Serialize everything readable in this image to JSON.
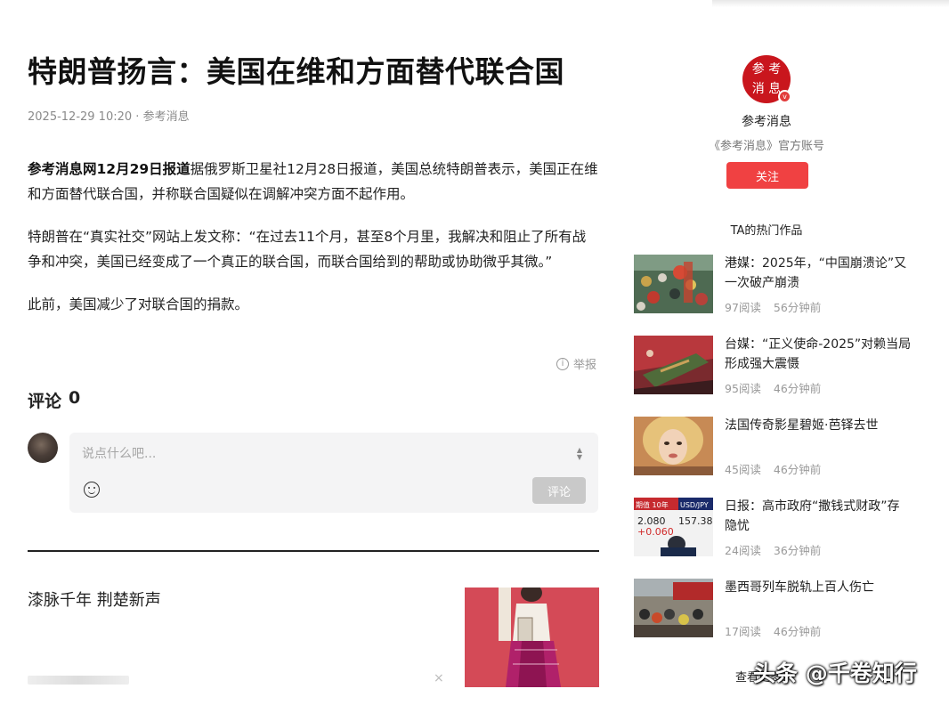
{
  "article": {
    "title": "特朗普扬言：美国在维和方面替代联合国",
    "date": "2025-12-29 10:20",
    "meta_sep": "·",
    "source": "参考消息",
    "p1_lead": "参考消息网12月29日报道",
    "p1_body": "据俄罗斯卫星社12月28日报道，美国总统特朗普表示，美国正在维和方面替代联合国，并称联合国疑似在调解冲突方面不起作用。",
    "p2": "特朗普在“真实社交”网站上发文称：“在过去11个月，甚至8个月里，我解决和阻止了所有战争和冲突，美国已经变成了一个真正的联合国，而联合国给到的帮助或协助微乎其微。”",
    "p3": "此前，美国减少了对联合国的捐款。",
    "report": "举报"
  },
  "comments": {
    "label": "评论",
    "count": "0",
    "placeholder": "说点什么吧...",
    "submit": "评论"
  },
  "recommendation": {
    "title": "漆脉千年 荆楚新声"
  },
  "sidebar": {
    "logo_text_1": "参 考",
    "logo_text_2": "消 息",
    "verified": "v",
    "account_name": "参考消息",
    "account_desc": "《参考消息》官方账号",
    "follow": "关注",
    "hot_title": "TA的热门作品",
    "items": [
      {
        "title": "港媒：2025年，“中国崩溃论”又一次破产崩溃",
        "reads": "97阅读",
        "time": "56分钟前"
      },
      {
        "title": "台媒：“正义使命-2025”对赖当局形成强大震慑",
        "reads": "95阅读",
        "time": "46分钟前"
      },
      {
        "title": "法国传奇影星碧姬·芭铎去世",
        "reads": "45阅读",
        "time": "46分钟前"
      },
      {
        "title": "日报：高市政府“撒钱式财政”存隐忧",
        "reads": "24阅读",
        "time": "36分钟前"
      },
      {
        "title": "墨西哥列车脱轨上百人伤亡",
        "reads": "17阅读",
        "time": "46分钟前"
      }
    ],
    "thumb4_text": {
      "a": "期值 10年",
      "b": "USD/JPY",
      "c": "2.080",
      "d": "157.38",
      "e": "+0.060"
    },
    "more": "查看更多"
  },
  "watermark": "头条 @千卷知行",
  "colors": {
    "accent": "#f04142",
    "brand": "#c9161d",
    "muted": "#999999"
  }
}
